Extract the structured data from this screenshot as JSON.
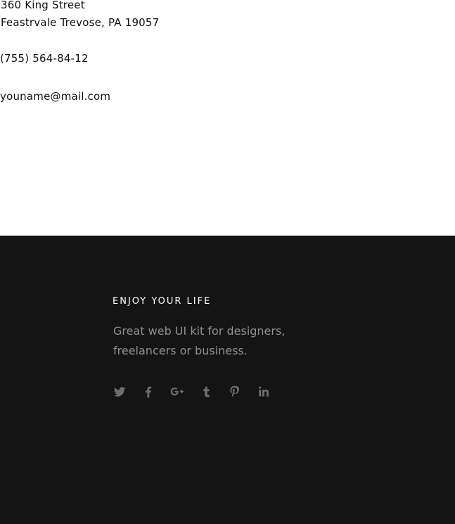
{
  "contact": {
    "address_line1": "360 King Street",
    "address_line2": "Feastrvale Trevose, PA 19057",
    "phone": "(755) 564-84-12",
    "email": "youname@mail.com"
  },
  "footer": {
    "title": "ENJOY YOUR LIFE",
    "tagline": "Great web UI kit for designers, freelancers or business.",
    "social_icons": [
      "twitter-icon",
      "facebook-icon",
      "google-plus-icon",
      "tumblr-icon",
      "pinterest-icon",
      "linkedin-icon"
    ],
    "background_color": "#141414",
    "icon_color": "#6e6e6e"
  }
}
